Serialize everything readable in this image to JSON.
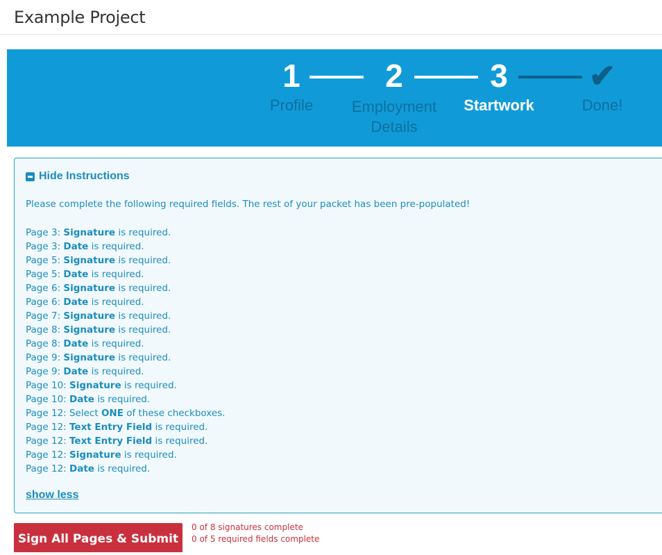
{
  "header": {
    "project_title": "Example Project"
  },
  "progress": {
    "steps": [
      {
        "number": "1",
        "label_line1": "Profile",
        "label_line2": ""
      },
      {
        "number": "2",
        "label_line1": "Employment",
        "label_line2": "Details"
      },
      {
        "number": "3",
        "label_line1": "Startwork",
        "label_line2": ""
      },
      {
        "number": "✔",
        "label_line1": "Done!",
        "label_line2": ""
      }
    ],
    "current_step": 3,
    "colors": {
      "banner": "#109bd8",
      "active": "#ffffff",
      "inactive": "#0d6f9e"
    }
  },
  "instructions": {
    "toggle_label": "Hide Instructions",
    "toggle_icon": "minus-square-icon",
    "intro": "Please complete the following required fields. The rest of your packet has been pre-populated!",
    "items": [
      {
        "prefix": "Page 3: ",
        "bold": "Signature",
        "suffix": " is required."
      },
      {
        "prefix": "Page 3: ",
        "bold": "Date",
        "suffix": " is required."
      },
      {
        "prefix": "Page 5: ",
        "bold": "Signature",
        "suffix": " is required."
      },
      {
        "prefix": "Page 5: ",
        "bold": "Date",
        "suffix": " is required."
      },
      {
        "prefix": "Page 6: ",
        "bold": "Signature",
        "suffix": " is required."
      },
      {
        "prefix": "Page 6: ",
        "bold": "Date",
        "suffix": " is required."
      },
      {
        "prefix": "Page 7: ",
        "bold": "Signature",
        "suffix": " is required."
      },
      {
        "prefix": "Page 8: ",
        "bold": "Signature",
        "suffix": " is required."
      },
      {
        "prefix": "Page 8: ",
        "bold": "Date",
        "suffix": " is required."
      },
      {
        "prefix": "Page 9: ",
        "bold": "Signature",
        "suffix": " is required."
      },
      {
        "prefix": "Page 9: ",
        "bold": "Date",
        "suffix": " is required."
      },
      {
        "prefix": "Page 10: ",
        "bold": "Signature",
        "suffix": " is required."
      },
      {
        "prefix": "Page 10: ",
        "bold": "Date",
        "suffix": " is required."
      },
      {
        "prefix": "Page 12: Select ",
        "bold": "ONE",
        "suffix": " of these checkboxes."
      },
      {
        "prefix": "Page 12: ",
        "bold": "Text Entry Field",
        "suffix": " is required."
      },
      {
        "prefix": "Page 12: ",
        "bold": "Text Entry Field",
        "suffix": " is required."
      },
      {
        "prefix": "Page 12: ",
        "bold": "Signature",
        "suffix": " is required."
      },
      {
        "prefix": "Page 12: ",
        "bold": "Date",
        "suffix": " is required."
      }
    ],
    "show_less_label": "show less",
    "accent_color": "#1a8dbf"
  },
  "footer": {
    "submit_label": "Sign All Pages & Submit",
    "signatures_status": "0 of 8 signatures complete",
    "fields_status": "0 of 5 required fields complete",
    "alert_color": "#c9303e"
  }
}
